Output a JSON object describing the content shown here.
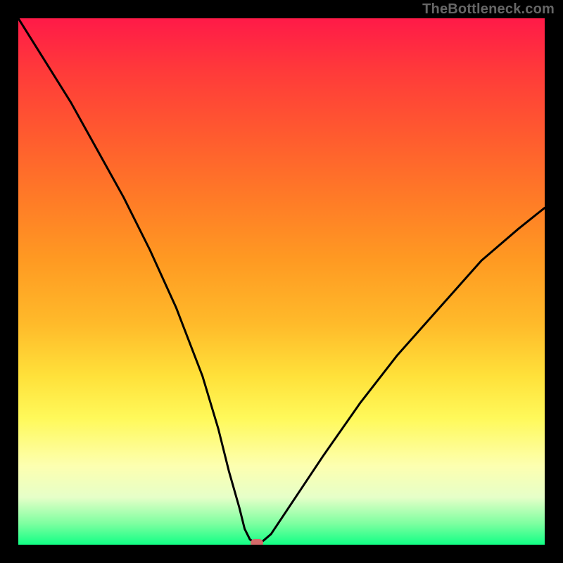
{
  "watermark": "TheBottleneck.com",
  "chart_data": {
    "type": "line",
    "title": "",
    "xlabel": "",
    "ylabel": "",
    "xlim": [
      0,
      100
    ],
    "ylim": [
      0,
      100
    ],
    "grid": false,
    "legend": false,
    "series": [
      {
        "name": "curve",
        "x": [
          0,
          5,
          10,
          15,
          20,
          25,
          30,
          35,
          38,
          40,
          42,
          43,
          44,
          45,
          46,
          48,
          52,
          58,
          65,
          72,
          80,
          88,
          95,
          100
        ],
        "y": [
          100,
          92,
          84,
          75,
          66,
          56,
          45,
          32,
          22,
          14,
          7,
          3,
          1,
          0.3,
          0.3,
          2,
          8,
          17,
          27,
          36,
          45,
          54,
          60,
          64
        ]
      }
    ],
    "marker": {
      "x": 45.3,
      "y": 0.3
    },
    "colors": {
      "curve": "#000000",
      "marker": "#d46a6a",
      "gradient_top": "#ff1a48",
      "gradient_bottom": "#11ff85"
    }
  }
}
